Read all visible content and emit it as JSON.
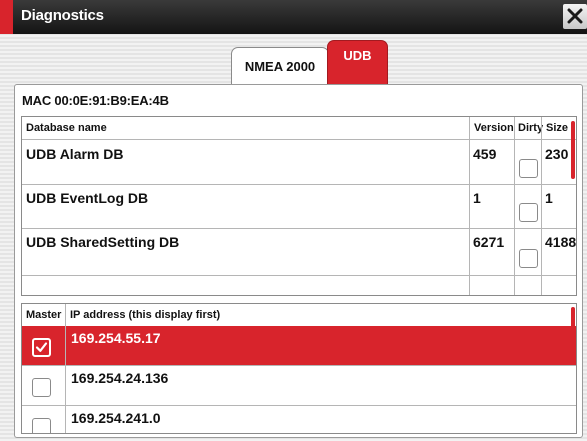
{
  "window": {
    "title": "Diagnostics"
  },
  "tabs": [
    {
      "label": "NMEA 2000",
      "active": false
    },
    {
      "label": "UDB",
      "active": true
    }
  ],
  "mac_label": "MAC 00:0E:91:B9:EA:4B",
  "database_table": {
    "headers": {
      "name": "Database name",
      "version": "Version",
      "dirty": "Dirty",
      "size": "Size"
    },
    "rows": [
      {
        "name": "UDB Alarm DB",
        "version": "459",
        "dirty": false,
        "size": "230"
      },
      {
        "name": "UDB EventLog DB",
        "version": "1",
        "dirty": false,
        "size": "1"
      },
      {
        "name": "UDB SharedSetting DB",
        "version": "6271",
        "dirty": false,
        "size": "4188"
      }
    ]
  },
  "ip_table": {
    "headers": {
      "master": "Master",
      "ip": "IP address (this display first)"
    },
    "rows": [
      {
        "ip": "169.254.55.17",
        "master": true
      },
      {
        "ip": "169.254.24.136",
        "master": false
      },
      {
        "ip": "169.254.241.0",
        "master": false
      }
    ]
  },
  "colors": {
    "accent": "#d8242c",
    "titlebar": "#1e1e1e"
  }
}
